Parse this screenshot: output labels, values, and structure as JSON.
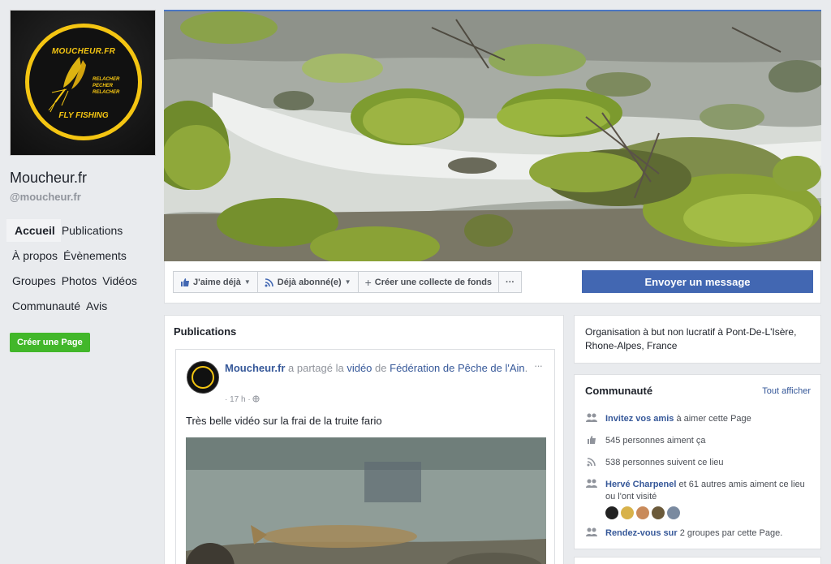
{
  "page": {
    "name": "Moucheur.fr",
    "handle": "@moucheur.fr",
    "logo": {
      "top": "MOUCHEUR.FR",
      "mid": [
        "RELACHER",
        "PECHER",
        "RELACHER"
      ],
      "bottom": "FLY FISHING"
    }
  },
  "nav": [
    {
      "label": "Accueil"
    },
    {
      "label": "Publications"
    },
    {
      "label": "À propos"
    },
    {
      "label": "Évènements"
    },
    {
      "label": "Groupes"
    },
    {
      "label": "Photos"
    },
    {
      "label": "Vidéos"
    },
    {
      "label": "Communauté"
    },
    {
      "label": "Avis"
    }
  ],
  "create_page_label": "Créer une Page",
  "actions": {
    "like": "J'aime déjà",
    "follow": "Déjà abonné(e)",
    "fundraiser": "Créer une collecte de fonds",
    "more": "···",
    "send": "Envoyer un message"
  },
  "publications": {
    "title": "Publications",
    "post": {
      "author": "Moucheur.fr",
      "shared": "a partagé la",
      "video_word": "vidéo",
      "of": "de",
      "source": "Fédération de Pêche de l'Ain",
      "time": "17 h",
      "text": "Très belle vidéo sur la frai de la truite fario",
      "more": "···"
    }
  },
  "about": {
    "text": "Organisation à but non lucratif à Pont-De-L'Isère, Rhone-Alpes, France"
  },
  "community": {
    "title": "Communauté",
    "see_all": "Tout afficher",
    "invite_link": "Invitez vos amis",
    "invite_rest": "à aimer cette Page",
    "likes": "545 personnes aiment ça",
    "follows": "538 personnes suivent ce lieu",
    "friend_link": "Hervé Charpenel",
    "friend_rest": "et 61 autres amis aiment ce lieu ou l'ont visité",
    "groups_link": "Rendez-vous sur",
    "groups_rest": "2 groupes par cette Page."
  },
  "colors": {
    "brand": "#4267b2",
    "link": "#365899",
    "green": "#42b72a",
    "logo": "#f4c512"
  }
}
